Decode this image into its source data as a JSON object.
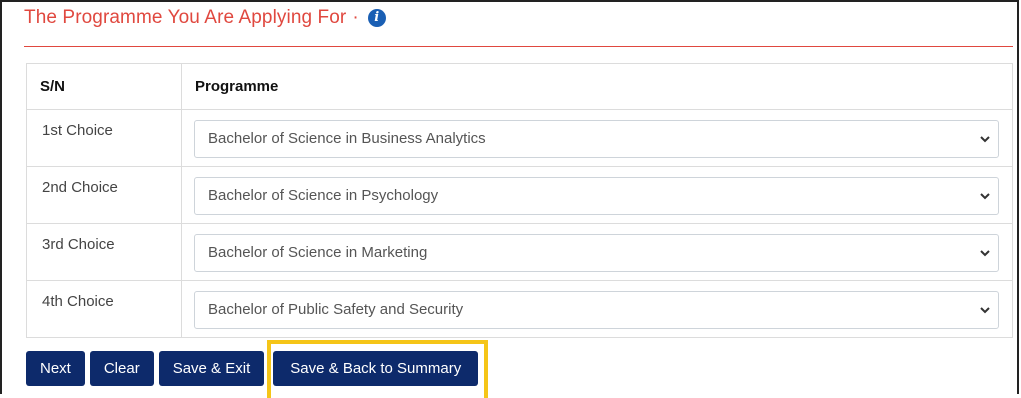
{
  "section": {
    "title": "The Programme You Are Applying For",
    "separator": "·",
    "info_icon": "info-circle-icon"
  },
  "table": {
    "headers": [
      "S/N",
      "Programme"
    ],
    "rows": [
      {
        "sn": "1st Choice",
        "programme": "Bachelor of Science in Business Analytics"
      },
      {
        "sn": "2nd Choice",
        "programme": "Bachelor of Science in Psychology"
      },
      {
        "sn": "3rd Choice",
        "programme": "Bachelor of Science in Marketing"
      },
      {
        "sn": "4th Choice",
        "programme": "Bachelor of Public Safety and Security"
      }
    ]
  },
  "buttons": {
    "next": "Next",
    "clear": "Clear",
    "save_exit": "Save & Exit",
    "save_back": "Save & Back to Summary"
  },
  "colors": {
    "title_red": "#e0483f",
    "button_navy": "#0d2a6b",
    "highlight_yellow": "#f5c518",
    "info_blue": "#1a5fb4"
  }
}
